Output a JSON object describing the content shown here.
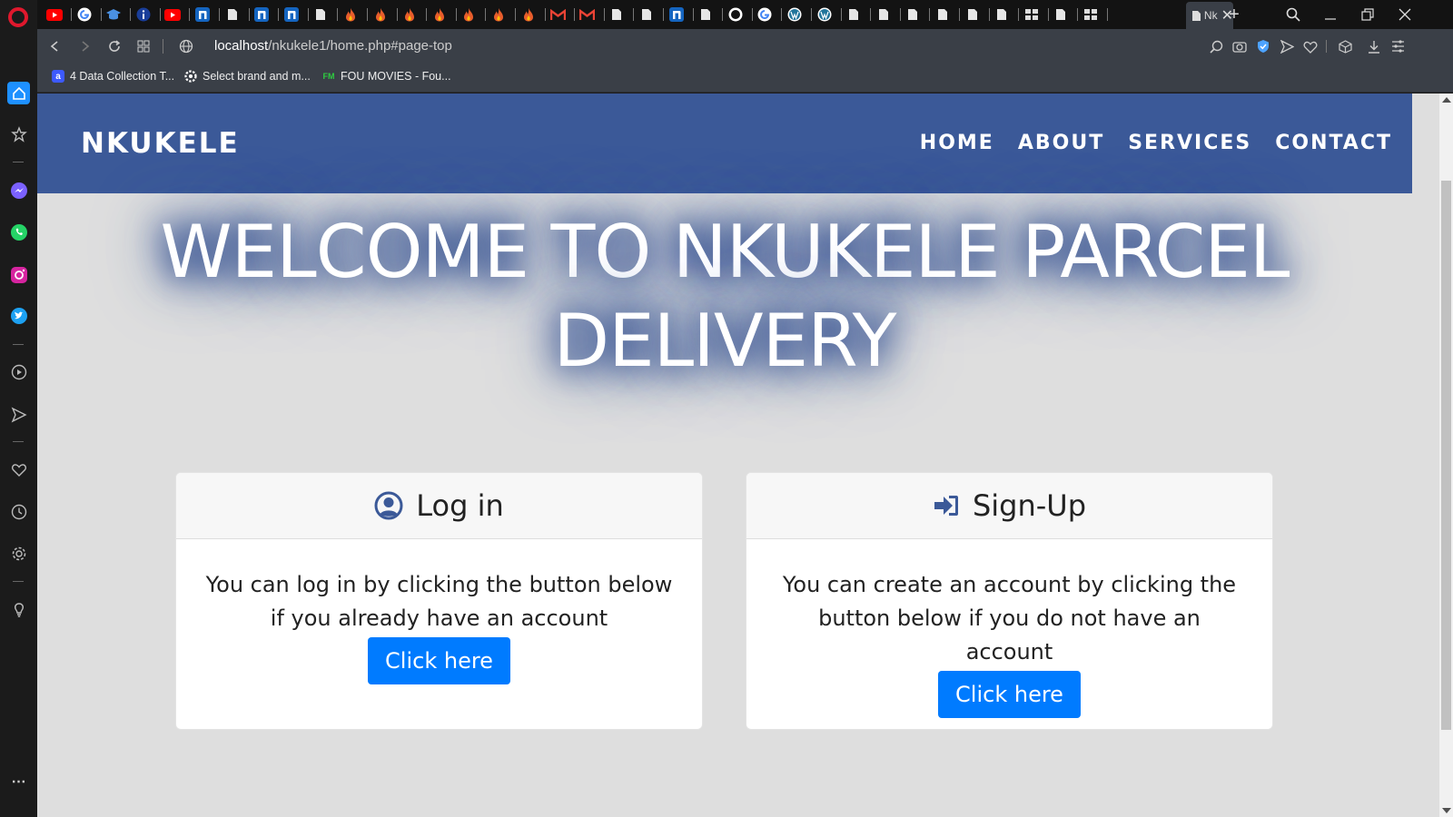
{
  "browser": {
    "active_tab_title": "Nk",
    "url_host": "localhost",
    "url_path": "/nkukele1/home.php#page-top",
    "bookmarks": [
      {
        "label": "4 Data Collection T...",
        "icon": "a-letter-icon",
        "color": "#3d5afe"
      },
      {
        "label": "Select brand and m...",
        "icon": "gear-icon",
        "color": "#ffffff"
      },
      {
        "label": "FOU MOVIES - Fou...",
        "icon": "fm-icon",
        "color": "#2ecc40"
      }
    ],
    "tab_icons": [
      "youtube-icon",
      "google-icon",
      "graduation-icon",
      "info-icon",
      "youtube-icon",
      "n-icon",
      "page-icon",
      "n-icon",
      "n-icon",
      "page-icon",
      "flame-icon",
      "flame-icon",
      "flame-icon",
      "flame-icon",
      "flame-icon",
      "flame-icon",
      "flame-icon",
      "gmail-icon",
      "gmail-icon",
      "page-icon",
      "page-icon",
      "n-icon",
      "page-icon",
      "github-icon",
      "google-icon",
      "wordpress-icon",
      "wordpress-icon",
      "page-icon",
      "page-icon",
      "page-icon",
      "page-icon",
      "page-icon",
      "page-icon",
      "grid-icon",
      "page-icon",
      "grid-icon"
    ]
  },
  "site": {
    "brand": "NKUKELE",
    "nav": [
      "HOME",
      "ABOUT",
      "SERVICES",
      "CONTACT"
    ],
    "hero_title": "WELCOME TO NKUKELE PARCEL DELIVERY",
    "cards": [
      {
        "title": "Log in",
        "icon": "user-circle-icon",
        "text": "You can log in by clicking the button below if you already have an account",
        "button": "Click here"
      },
      {
        "title": "Sign-Up",
        "icon": "sign-in-icon",
        "text": "You can create an account by clicking the button below if you do not have an account",
        "button": "Click here"
      }
    ]
  },
  "colors": {
    "navbar": "#3b5998",
    "button": "#007bff",
    "page_bg": "#dedede"
  }
}
